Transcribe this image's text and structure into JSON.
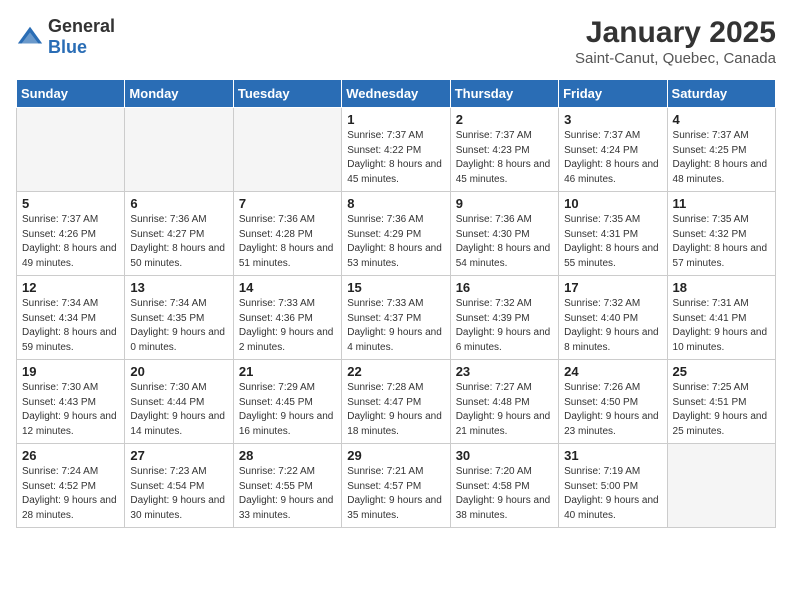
{
  "logo": {
    "general": "General",
    "blue": "Blue"
  },
  "header": {
    "month": "January 2025",
    "location": "Saint-Canut, Quebec, Canada"
  },
  "days_of_week": [
    "Sunday",
    "Monday",
    "Tuesday",
    "Wednesday",
    "Thursday",
    "Friday",
    "Saturday"
  ],
  "weeks": [
    [
      {
        "day": "",
        "sunrise": "",
        "sunset": "",
        "daylight": "",
        "empty": true
      },
      {
        "day": "",
        "sunrise": "",
        "sunset": "",
        "daylight": "",
        "empty": true
      },
      {
        "day": "",
        "sunrise": "",
        "sunset": "",
        "daylight": "",
        "empty": true
      },
      {
        "day": "1",
        "sunrise": "Sunrise: 7:37 AM",
        "sunset": "Sunset: 4:22 PM",
        "daylight": "Daylight: 8 hours and 45 minutes.",
        "empty": false
      },
      {
        "day": "2",
        "sunrise": "Sunrise: 7:37 AM",
        "sunset": "Sunset: 4:23 PM",
        "daylight": "Daylight: 8 hours and 45 minutes.",
        "empty": false
      },
      {
        "day": "3",
        "sunrise": "Sunrise: 7:37 AM",
        "sunset": "Sunset: 4:24 PM",
        "daylight": "Daylight: 8 hours and 46 minutes.",
        "empty": false
      },
      {
        "day": "4",
        "sunrise": "Sunrise: 7:37 AM",
        "sunset": "Sunset: 4:25 PM",
        "daylight": "Daylight: 8 hours and 48 minutes.",
        "empty": false
      }
    ],
    [
      {
        "day": "5",
        "sunrise": "Sunrise: 7:37 AM",
        "sunset": "Sunset: 4:26 PM",
        "daylight": "Daylight: 8 hours and 49 minutes.",
        "empty": false
      },
      {
        "day": "6",
        "sunrise": "Sunrise: 7:36 AM",
        "sunset": "Sunset: 4:27 PM",
        "daylight": "Daylight: 8 hours and 50 minutes.",
        "empty": false
      },
      {
        "day": "7",
        "sunrise": "Sunrise: 7:36 AM",
        "sunset": "Sunset: 4:28 PM",
        "daylight": "Daylight: 8 hours and 51 minutes.",
        "empty": false
      },
      {
        "day": "8",
        "sunrise": "Sunrise: 7:36 AM",
        "sunset": "Sunset: 4:29 PM",
        "daylight": "Daylight: 8 hours and 53 minutes.",
        "empty": false
      },
      {
        "day": "9",
        "sunrise": "Sunrise: 7:36 AM",
        "sunset": "Sunset: 4:30 PM",
        "daylight": "Daylight: 8 hours and 54 minutes.",
        "empty": false
      },
      {
        "day": "10",
        "sunrise": "Sunrise: 7:35 AM",
        "sunset": "Sunset: 4:31 PM",
        "daylight": "Daylight: 8 hours and 55 minutes.",
        "empty": false
      },
      {
        "day": "11",
        "sunrise": "Sunrise: 7:35 AM",
        "sunset": "Sunset: 4:32 PM",
        "daylight": "Daylight: 8 hours and 57 minutes.",
        "empty": false
      }
    ],
    [
      {
        "day": "12",
        "sunrise": "Sunrise: 7:34 AM",
        "sunset": "Sunset: 4:34 PM",
        "daylight": "Daylight: 8 hours and 59 minutes.",
        "empty": false
      },
      {
        "day": "13",
        "sunrise": "Sunrise: 7:34 AM",
        "sunset": "Sunset: 4:35 PM",
        "daylight": "Daylight: 9 hours and 0 minutes.",
        "empty": false
      },
      {
        "day": "14",
        "sunrise": "Sunrise: 7:33 AM",
        "sunset": "Sunset: 4:36 PM",
        "daylight": "Daylight: 9 hours and 2 minutes.",
        "empty": false
      },
      {
        "day": "15",
        "sunrise": "Sunrise: 7:33 AM",
        "sunset": "Sunset: 4:37 PM",
        "daylight": "Daylight: 9 hours and 4 minutes.",
        "empty": false
      },
      {
        "day": "16",
        "sunrise": "Sunrise: 7:32 AM",
        "sunset": "Sunset: 4:39 PM",
        "daylight": "Daylight: 9 hours and 6 minutes.",
        "empty": false
      },
      {
        "day": "17",
        "sunrise": "Sunrise: 7:32 AM",
        "sunset": "Sunset: 4:40 PM",
        "daylight": "Daylight: 9 hours and 8 minutes.",
        "empty": false
      },
      {
        "day": "18",
        "sunrise": "Sunrise: 7:31 AM",
        "sunset": "Sunset: 4:41 PM",
        "daylight": "Daylight: 9 hours and 10 minutes.",
        "empty": false
      }
    ],
    [
      {
        "day": "19",
        "sunrise": "Sunrise: 7:30 AM",
        "sunset": "Sunset: 4:43 PM",
        "daylight": "Daylight: 9 hours and 12 minutes.",
        "empty": false
      },
      {
        "day": "20",
        "sunrise": "Sunrise: 7:30 AM",
        "sunset": "Sunset: 4:44 PM",
        "daylight": "Daylight: 9 hours and 14 minutes.",
        "empty": false
      },
      {
        "day": "21",
        "sunrise": "Sunrise: 7:29 AM",
        "sunset": "Sunset: 4:45 PM",
        "daylight": "Daylight: 9 hours and 16 minutes.",
        "empty": false
      },
      {
        "day": "22",
        "sunrise": "Sunrise: 7:28 AM",
        "sunset": "Sunset: 4:47 PM",
        "daylight": "Daylight: 9 hours and 18 minutes.",
        "empty": false
      },
      {
        "day": "23",
        "sunrise": "Sunrise: 7:27 AM",
        "sunset": "Sunset: 4:48 PM",
        "daylight": "Daylight: 9 hours and 21 minutes.",
        "empty": false
      },
      {
        "day": "24",
        "sunrise": "Sunrise: 7:26 AM",
        "sunset": "Sunset: 4:50 PM",
        "daylight": "Daylight: 9 hours and 23 minutes.",
        "empty": false
      },
      {
        "day": "25",
        "sunrise": "Sunrise: 7:25 AM",
        "sunset": "Sunset: 4:51 PM",
        "daylight": "Daylight: 9 hours and 25 minutes.",
        "empty": false
      }
    ],
    [
      {
        "day": "26",
        "sunrise": "Sunrise: 7:24 AM",
        "sunset": "Sunset: 4:52 PM",
        "daylight": "Daylight: 9 hours and 28 minutes.",
        "empty": false
      },
      {
        "day": "27",
        "sunrise": "Sunrise: 7:23 AM",
        "sunset": "Sunset: 4:54 PM",
        "daylight": "Daylight: 9 hours and 30 minutes.",
        "empty": false
      },
      {
        "day": "28",
        "sunrise": "Sunrise: 7:22 AM",
        "sunset": "Sunset: 4:55 PM",
        "daylight": "Daylight: 9 hours and 33 minutes.",
        "empty": false
      },
      {
        "day": "29",
        "sunrise": "Sunrise: 7:21 AM",
        "sunset": "Sunset: 4:57 PM",
        "daylight": "Daylight: 9 hours and 35 minutes.",
        "empty": false
      },
      {
        "day": "30",
        "sunrise": "Sunrise: 7:20 AM",
        "sunset": "Sunset: 4:58 PM",
        "daylight": "Daylight: 9 hours and 38 minutes.",
        "empty": false
      },
      {
        "day": "31",
        "sunrise": "Sunrise: 7:19 AM",
        "sunset": "Sunset: 5:00 PM",
        "daylight": "Daylight: 9 hours and 40 minutes.",
        "empty": false
      },
      {
        "day": "",
        "sunrise": "",
        "sunset": "",
        "daylight": "",
        "empty": true
      }
    ]
  ]
}
